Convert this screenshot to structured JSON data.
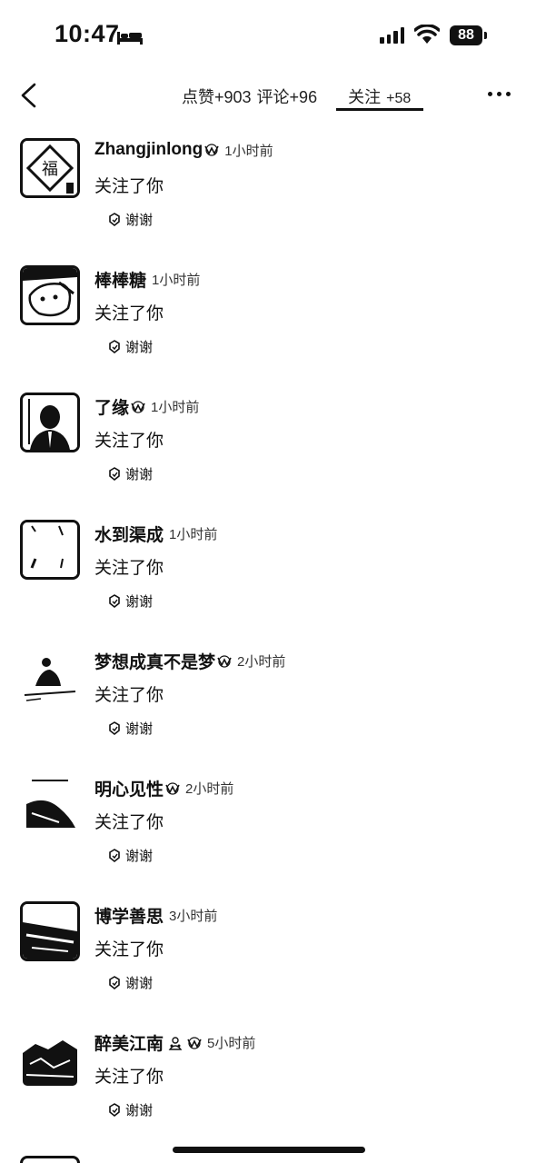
{
  "status_bar": {
    "time": "10:47",
    "battery": "88"
  },
  "header": {
    "likes": "点赞+903",
    "comments": "评论+96",
    "follow_label": "关注",
    "follow_count": "+58"
  },
  "items": [
    {
      "name": "Zhangjinlong",
      "time": "1小时前",
      "action": "关注了你",
      "thanks": "谢谢"
    },
    {
      "name": "棒棒糖",
      "time": "1小时前",
      "action": "关注了你",
      "thanks": "谢谢"
    },
    {
      "name": "了缘",
      "time": "1小时前",
      "action": "关注了你",
      "thanks": "谢谢"
    },
    {
      "name": "水到渠成",
      "time": "1小时前",
      "action": "关注了你",
      "thanks": "谢谢"
    },
    {
      "name": "梦想成真不是梦",
      "time": "2小时前",
      "action": "关注了你",
      "thanks": "谢谢"
    },
    {
      "name": "明心见性",
      "time": "2小时前",
      "action": "关注了你",
      "thanks": "谢谢"
    },
    {
      "name": "博学善思",
      "time": "3小时前",
      "action": "关注了你",
      "thanks": "谢谢"
    },
    {
      "name": "醉美江南",
      "time": "5小时前",
      "action": "关注了你",
      "thanks": "谢谢"
    }
  ]
}
